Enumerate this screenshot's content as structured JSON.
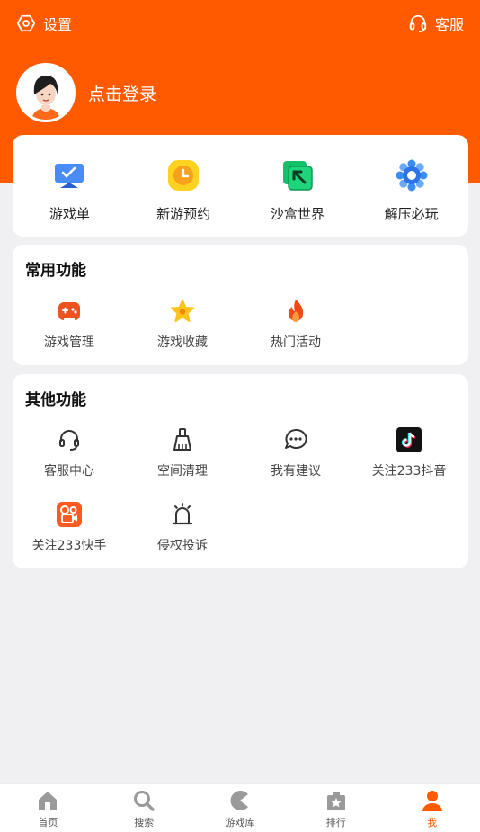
{
  "topbar": {
    "settings_label": "设置",
    "service_label": "客服"
  },
  "profile": {
    "login_text": "点击登录"
  },
  "shortcuts": [
    {
      "label": "游戏单",
      "icon": "game-list-icon"
    },
    {
      "label": "新游预约",
      "icon": "clock-icon"
    },
    {
      "label": "沙盒世界",
      "icon": "sandbox-icon"
    },
    {
      "label": "解压必玩",
      "icon": "gear-flower-icon"
    }
  ],
  "common": {
    "title": "常用功能",
    "items": [
      {
        "label": "游戏管理",
        "icon": "gamepad-icon"
      },
      {
        "label": "游戏收藏",
        "icon": "star-icon"
      },
      {
        "label": "热门活动",
        "icon": "fire-icon"
      }
    ]
  },
  "other": {
    "title": "其他功能",
    "items": [
      {
        "label": "客服中心",
        "icon": "headset-icon"
      },
      {
        "label": "空间清理",
        "icon": "broom-icon"
      },
      {
        "label": "我有建议",
        "icon": "chat-icon"
      },
      {
        "label": "关注233抖音",
        "icon": "tiktok-icon"
      },
      {
        "label": "关注233快手",
        "icon": "kuaishou-icon"
      },
      {
        "label": "侵权投诉",
        "icon": "alarm-icon"
      }
    ]
  },
  "tabs": [
    {
      "label": "首页",
      "icon": "home-icon"
    },
    {
      "label": "搜索",
      "icon": "search-icon"
    },
    {
      "label": "游戏库",
      "icon": "pacman-icon"
    },
    {
      "label": "排行",
      "icon": "ranking-icon"
    },
    {
      "label": "我",
      "icon": "person-icon",
      "active": true
    }
  ],
  "colors": {
    "brand": "#ff5a00",
    "background": "#f0f0f3"
  }
}
